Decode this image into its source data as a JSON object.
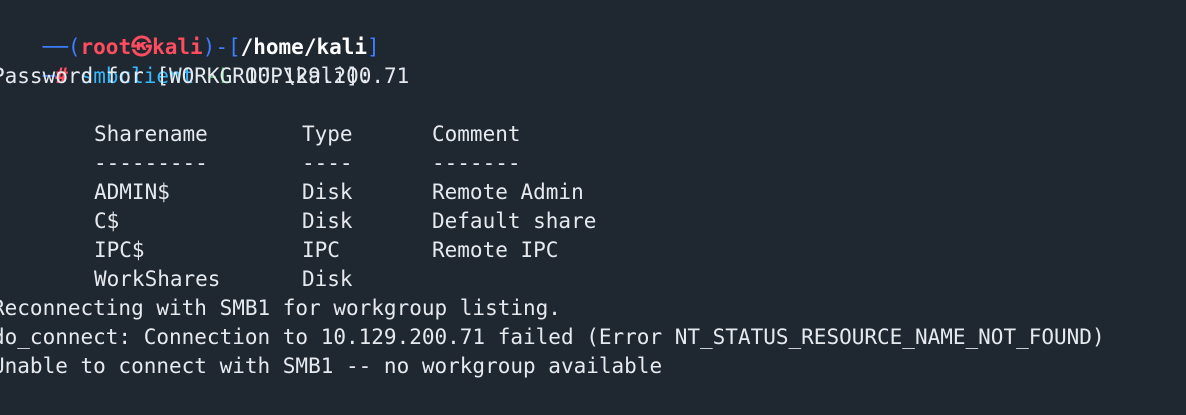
{
  "prompt": {
    "corner_top": "──(",
    "user": "root",
    "at_symbol": "㉿",
    "host": "kali",
    "bracket_mid": ")-[",
    "path": "/home/kali",
    "bracket_end": "]",
    "corner_bottom": "─",
    "hash": "#"
  },
  "command": {
    "name": "smbclient",
    "flag": "-L",
    "arg": "10.129.200.71"
  },
  "output": {
    "password_line": "Password for [WORKGROUP\\kali]:",
    "table_headers": [
      "Sharename",
      "Type",
      "Comment"
    ],
    "table_underlines": [
      "---------",
      "----",
      "-------"
    ],
    "rows": [
      [
        "ADMIN$",
        "Disk",
        "Remote Admin"
      ],
      [
        "C$",
        "Disk",
        "Default share"
      ],
      [
        "IPC$",
        "IPC",
        "Remote IPC"
      ],
      [
        "WorkShares",
        "Disk",
        ""
      ]
    ],
    "messages": [
      "Reconnecting with SMB1 for workgroup listing.",
      "do_connect: Connection to 10.129.200.71 failed (Error NT_STATUS_RESOURCE_NAME_NOT_FOUND)",
      "Unable to connect with SMB1 -- no workgroup available"
    ]
  },
  "colors": {
    "background": "#1f2731",
    "prompt_line": "#3d7dff",
    "user_host": "#ff4d5f",
    "command": "#36b9ff",
    "flag": "#52c46a",
    "text": "#e6eaef"
  }
}
